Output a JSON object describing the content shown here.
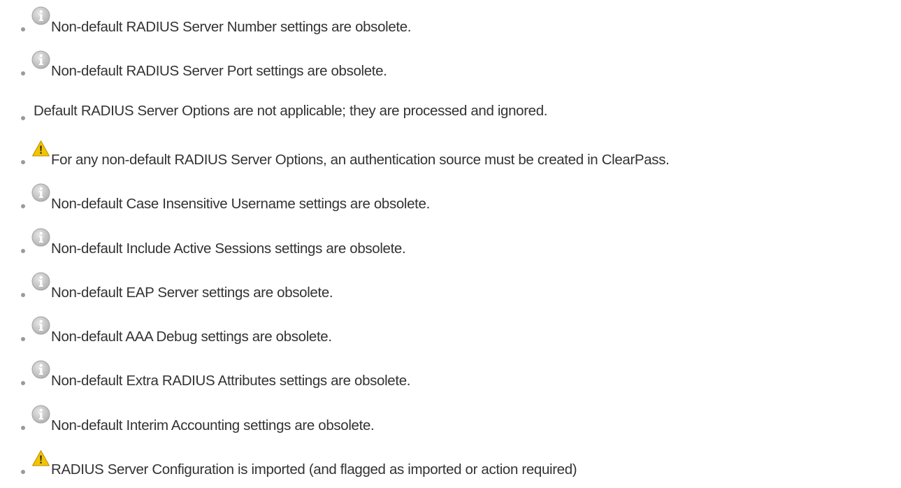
{
  "items": [
    {
      "icon": "info-icon",
      "text": "Non-default RADIUS Server Number settings are obsolete."
    },
    {
      "icon": "info-icon",
      "text": "Non-default RADIUS Server Port settings are obsolete."
    },
    {
      "icon": "",
      "text": "Default RADIUS Server Options are not applicable; they are processed and ignored."
    },
    {
      "icon": "warning-icon",
      "text": "For any non-default RADIUS Server Options, an authentication source must be created in ClearPass."
    },
    {
      "icon": "info-icon",
      "text": "Non-default Case Insensitive Username settings are obsolete."
    },
    {
      "icon": "info-icon",
      "text": "Non-default Include Active Sessions settings are obsolete."
    },
    {
      "icon": "info-icon",
      "text": "Non-default EAP Server settings are obsolete."
    },
    {
      "icon": "info-icon",
      "text": "Non-default AAA Debug settings are obsolete."
    },
    {
      "icon": "info-icon",
      "text": "Non-default Extra RADIUS Attributes settings are obsolete."
    },
    {
      "icon": "info-icon",
      "text": "Non-default Interim Accounting settings are obsolete."
    },
    {
      "icon": "warning-icon",
      "text": "RADIUS Server Configuration is imported (and flagged as imported or action required)"
    }
  ],
  "colors": {
    "text": "#333333",
    "bullet": "#9a9a9a",
    "info_icon": "#b0b0b0",
    "warning_icon": "#f2c500"
  }
}
